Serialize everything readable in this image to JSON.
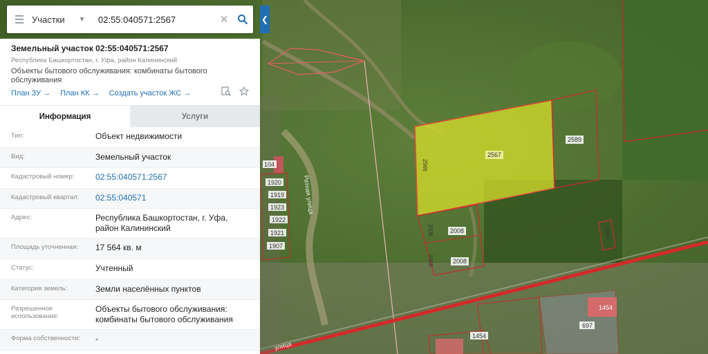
{
  "search": {
    "layer": "Участки",
    "value": "02:55:040571:2567"
  },
  "object": {
    "title": "Земельный участок 02:55:040571:2567",
    "region": "Республика Башкортостан, г. Уфа, район Калининский",
    "purpose": "Объекты бытового обслуживания: комбинаты бытового обслуживания",
    "links": [
      "План ЗУ →",
      "План КК →",
      "Создать участок ЖС →"
    ]
  },
  "tabs": [
    {
      "label": "Информация",
      "active": true
    },
    {
      "label": "Услуги",
      "active": false
    }
  ],
  "rows": [
    {
      "label": "Тип:",
      "value": "Объект недвижимости",
      "link": false
    },
    {
      "label": "Вид:",
      "value": "Земельный участок",
      "link": false
    },
    {
      "label": "Кадастровый номер:",
      "value": "02:55:040571:2567",
      "link": true
    },
    {
      "label": "Кадастровый квартал:",
      "value": "02:55:040571",
      "link": true
    },
    {
      "label": "Адрес:",
      "value": "Республика Башкортостан, г. Уфа, район Калининский",
      "link": false
    },
    {
      "label": "Площадь уточненная:",
      "value": "17 564 кв. м",
      "link": false
    },
    {
      "label": "Статус:",
      "value": "Учтенный",
      "link": false
    },
    {
      "label": "Категория земель:",
      "value": "Земли населённых пунктов",
      "link": false
    },
    {
      "label": "Разрешенное использование:",
      "value": "Объекты бытового обслуживания: комбинаты бытового обслуживания",
      "link": false
    },
    {
      "label": "Форма собственности:",
      "value": "-",
      "link": false
    }
  ],
  "map_labels": {
    "selected": "2567",
    "side": "2566",
    "p2589": "2589",
    "p2008a": "2008",
    "p2008b": "2008",
    "p2008c": "2008",
    "p2008d": "2008",
    "p2390": "2390",
    "p104": "104",
    "p1920": "1920",
    "p1919": "1919",
    "p1923": "1923",
    "p1922": "1922",
    "p1921": "1921",
    "p1907": "1907",
    "p697": "697",
    "p1454a": "1454",
    "p1454b": "1454",
    "street1": "Ратная улица",
    "street2": "улица"
  },
  "icons": {
    "menu": "menu-icon",
    "search": "search-icon",
    "clear": "close-icon",
    "collapse": "chevron-left-icon",
    "print": "document-search-icon",
    "favorite": "star-icon"
  }
}
